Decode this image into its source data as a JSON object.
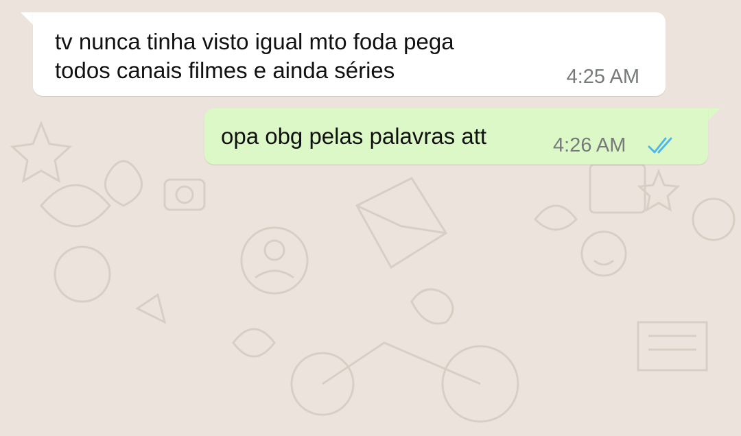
{
  "chat": {
    "messages": [
      {
        "direction": "incoming",
        "text": "tv nunca tinha visto igual mto foda pega\ntodos canais filmes e ainda séries",
        "time": "4:25 AM"
      },
      {
        "direction": "outgoing",
        "text": "opa obg pelas palavras att",
        "time": "4:26 AM",
        "status_icon": "double-check-read-icon"
      }
    ]
  },
  "colors": {
    "background": "#ece4dc",
    "incoming_bubble": "#ffffff",
    "outgoing_bubble": "#dcf8c6",
    "read_ticks": "#4fb6ec",
    "timestamp": "#767a7a"
  }
}
